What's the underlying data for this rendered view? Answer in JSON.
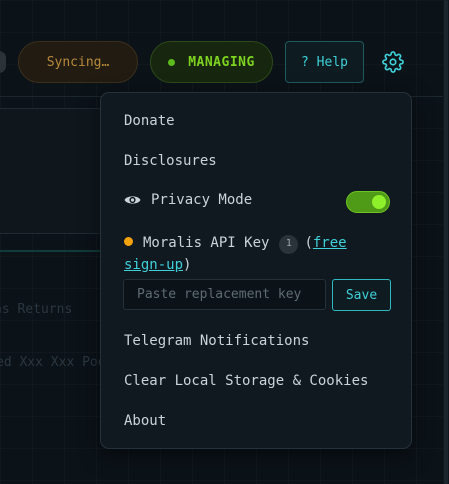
{
  "header": {
    "syncing_label": "Syncing…",
    "managing_label": "MANAGING",
    "help_label": "? Help",
    "settings_icon": "gear-icon"
  },
  "background": {
    "faded_text_1": "ns Returns",
    "faded_text_2": "ed Xxx Xxx Pool"
  },
  "menu": {
    "donate": "Donate",
    "disclosures": "Disclosures",
    "privacy_mode": "Privacy Mode",
    "privacy_mode_on": true,
    "moralis_label": "Moralis API Key",
    "moralis_badge": "1",
    "moralis_paren_open": "(",
    "moralis_link": "free sign-up",
    "moralis_paren_close": ")",
    "key_placeholder": "Paste replacement key",
    "save_label": "Save",
    "telegram": "Telegram Notifications",
    "clear_storage": "Clear Local Storage & Cookies",
    "about": "About"
  },
  "colors": {
    "accent": "#3fd0d8",
    "managing": "#7ed321",
    "syncing": "#b88a3a",
    "warning_dot": "#f2a20c",
    "toggle_on": "#4f9b17"
  }
}
